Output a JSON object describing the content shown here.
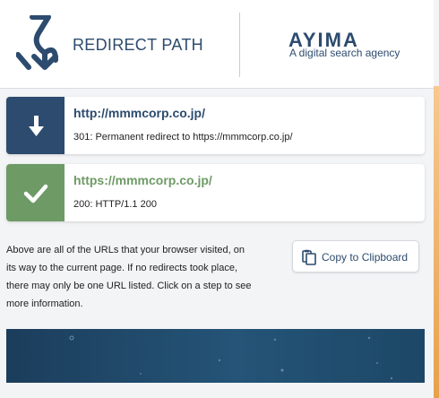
{
  "header": {
    "app_title": "REDIRECT PATH",
    "brand": "AYIMA",
    "tagline": "A digital search agency"
  },
  "steps": [
    {
      "url": "http://mmmcorp.co.jp/",
      "description": "301: Permanent redirect to https://mmmcorp.co.jp/",
      "icon": "arrow-down-icon",
      "color": "#2c4b6e"
    },
    {
      "url": "https://mmmcorp.co.jp/",
      "description": "200: HTTP/1.1 200",
      "icon": "checkmark-icon",
      "color": "#6e9a66"
    }
  ],
  "info": {
    "text": "Above are all of the URLs that your browser visited, on its way to the current page. If no redirects took place, there may only be one URL listed. Click on a step to see more information."
  },
  "copy_button": {
    "label": "Copy to Clipboard",
    "icon": "clipboard-icon"
  }
}
